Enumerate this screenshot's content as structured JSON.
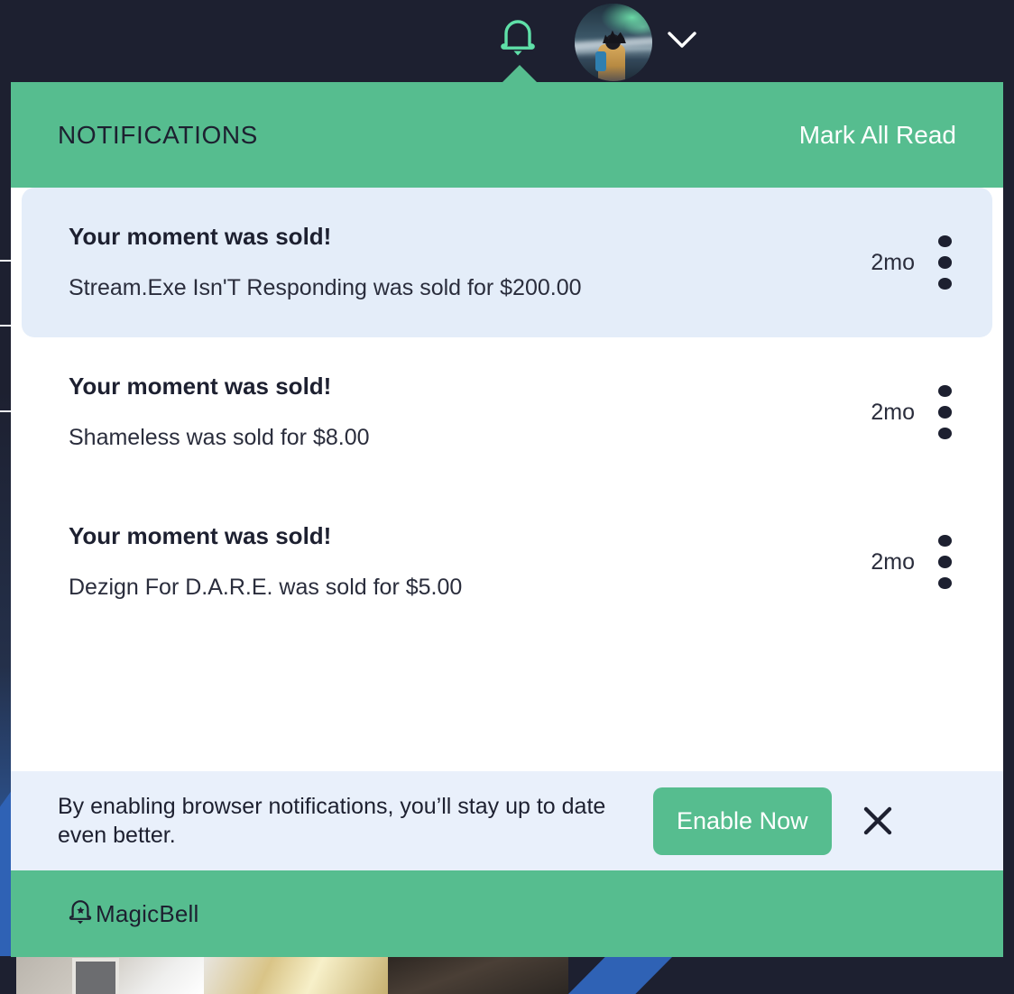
{
  "topbar": {
    "bell_icon": "bell-icon",
    "avatar_alt": "user-avatar",
    "chevron_icon": "chevron-down-icon"
  },
  "panel": {
    "title": "NOTIFICATIONS",
    "mark_all_read_label": "Mark All Read",
    "header_color": "#56bd8f",
    "unread_color": "#e4edf9",
    "accent_color": "#56bd8f",
    "text_color": "#1d2030"
  },
  "notifications": [
    {
      "title": "Your moment was sold!",
      "body": "Stream.Exe Isn'T Responding was sold for $200.00",
      "time": "2mo",
      "unread": true,
      "menu_icon": "kebab-menu-icon"
    },
    {
      "title": "Your moment was sold!",
      "body": "Shameless was sold for $8.00",
      "time": "2mo",
      "unread": false,
      "menu_icon": "kebab-menu-icon"
    },
    {
      "title": "Your moment was sold!",
      "body": "Dezign For D.A.R.E. was sold for $5.00",
      "time": "2mo",
      "unread": false,
      "menu_icon": "kebab-menu-icon"
    }
  ],
  "banner": {
    "text": "By enabling browser notifications, you’ll stay up to date even better.",
    "button_label": "Enable Now",
    "close_icon": "close-icon",
    "background_color": "#e9f0fb"
  },
  "footer": {
    "brand_name": "MagicBell",
    "brand_icon": "magicbell-logo-icon"
  }
}
